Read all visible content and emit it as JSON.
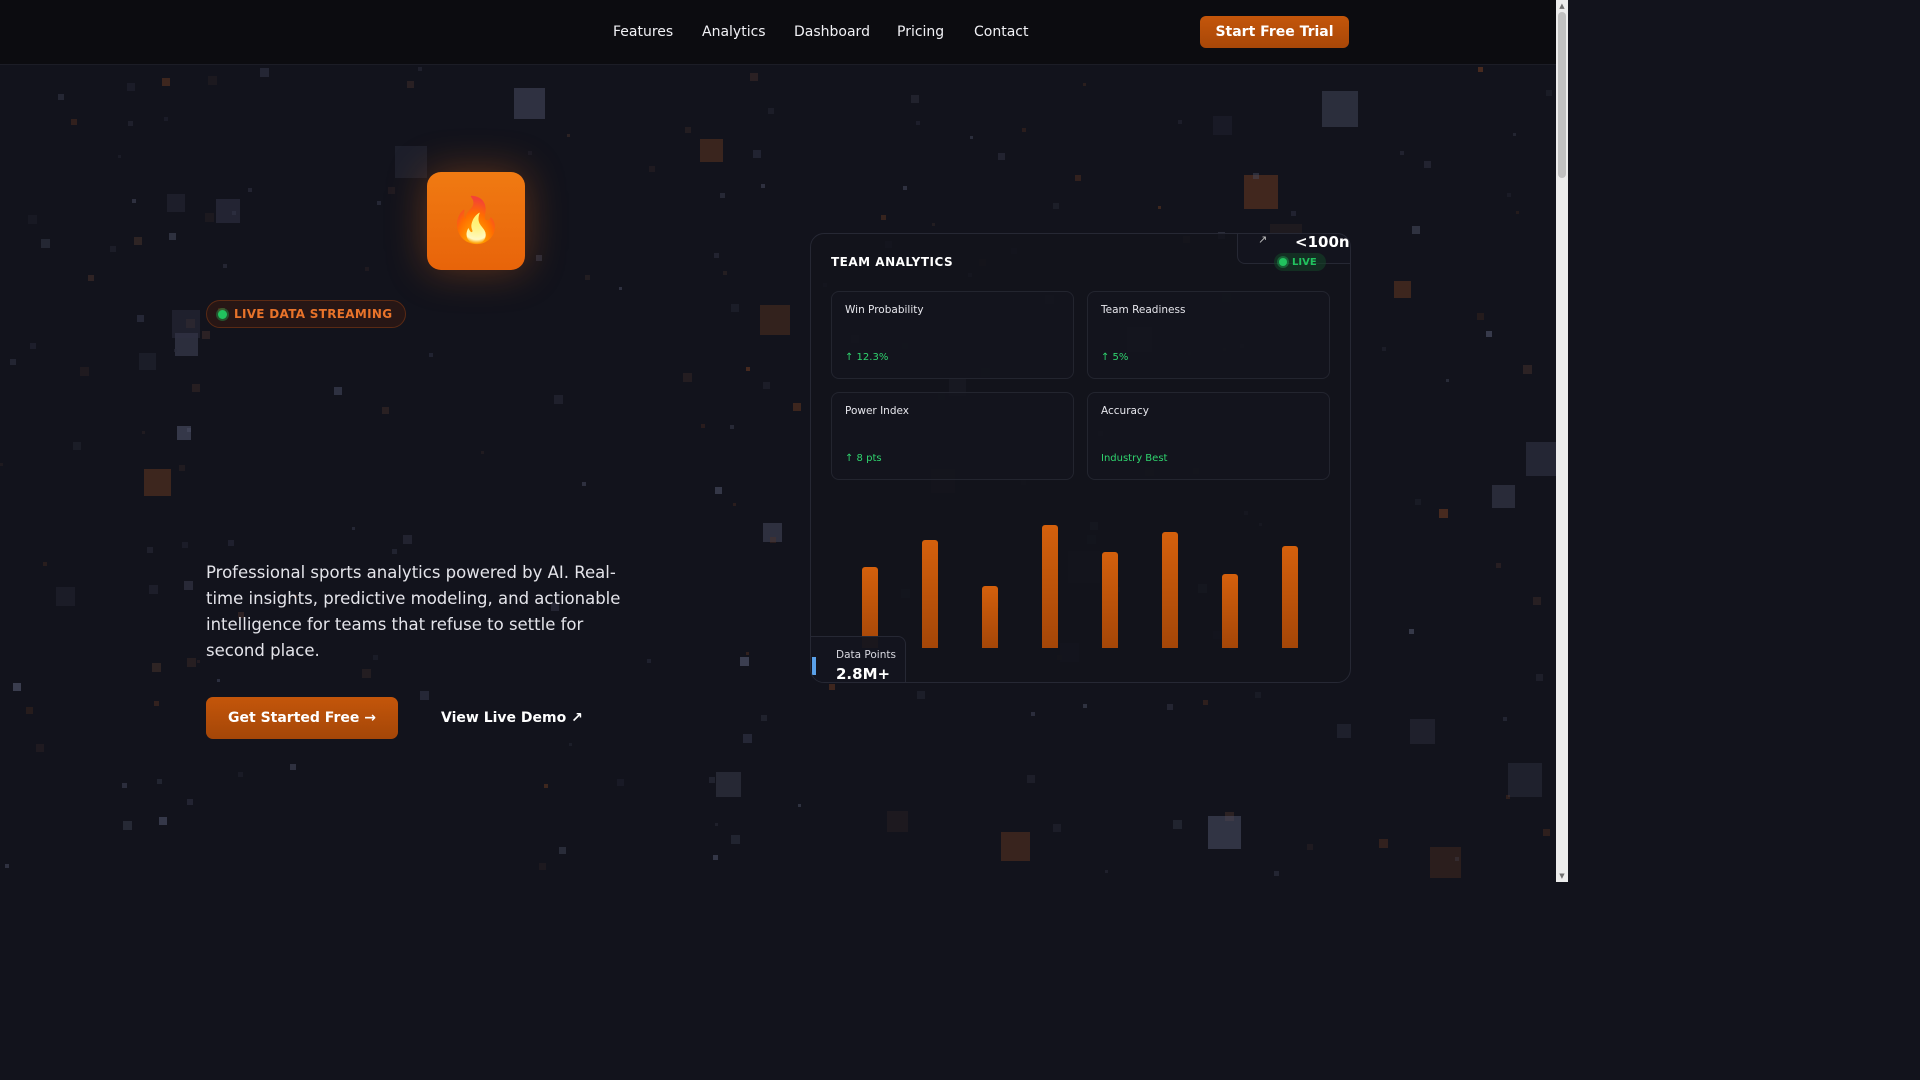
{
  "nav": {
    "links": [
      "Features",
      "Analytics",
      "Dashboard",
      "Pricing",
      "Contact"
    ],
    "cta": "Start Free Trial"
  },
  "hero": {
    "logo_icon": "🔥",
    "badge": "LIVE DATA STREAMING",
    "description": "Professional sports analytics powered by AI. Real-time insights, predictive modeling, and actionable intelligence for teams that refuse to settle for second place.",
    "primary_cta": "Get Started Free →",
    "secondary_cta": "View Live Demo ↗"
  },
  "dashboard": {
    "title": "TEAM ANALYTICS",
    "live_label": "LIVE",
    "metrics": [
      {
        "label": "Win Probability",
        "change": "↑ 12.3%"
      },
      {
        "label": "Team Readiness",
        "change": "↑ 5%"
      },
      {
        "label": "Power Index",
        "change": "↑ 8 pts"
      },
      {
        "label": "Accuracy",
        "change": "Industry Best"
      }
    ],
    "bar_levels": [
      0.66,
      0.88,
      0.5,
      1.0,
      0.78,
      0.94,
      0.6,
      0.83
    ],
    "data_points_label": "Data Points",
    "data_points_value": "2.8M+",
    "latency_value": "<100n"
  },
  "colors": {
    "accent": "#e8640a",
    "live_green": "#21c25e",
    "background": "#12131c"
  },
  "icons": {
    "logo": "flame-icon",
    "data_points": "database-icon",
    "latency": "lightning-icon"
  }
}
